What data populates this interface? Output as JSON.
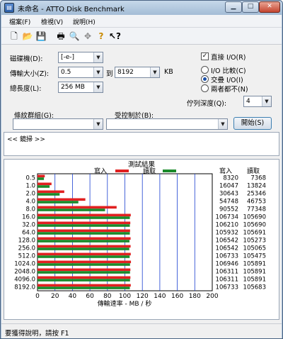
{
  "window": {
    "title": "未命名 - ATTO Disk Benchmark"
  },
  "menu": [
    {
      "label": "檔案(F)"
    },
    {
      "label": "檢視(V)"
    },
    {
      "label": "說明(H)"
    }
  ],
  "toolbar_icons": [
    "new-icon",
    "open-icon",
    "save-icon",
    "print-icon",
    "print-preview-icon",
    "move-icon",
    "help-icon",
    "context-help-icon"
  ],
  "settings": {
    "drive_label": "磁碟機(D):",
    "drive_value": "[-e-]",
    "transfer_label": "傳輸大小(Z):",
    "transfer_from": "0.5",
    "transfer_to_label": "到",
    "transfer_to": "8192",
    "transfer_unit": "KB",
    "total_label": "總長度(L):",
    "total_value": "256 MB",
    "direct_io_label": "直接 I/O(R)",
    "direct_io_checked": true,
    "radio_options": [
      {
        "label": "I/O 比較(C)",
        "selected": false
      },
      {
        "label": "交疊 I/O(I)",
        "selected": true
      },
      {
        "label": "兩者都不(N)",
        "selected": false
      }
    ],
    "queue_label": "佇列深度(Q):",
    "queue_value": "4",
    "control_group_label": "條紋群組(G):",
    "controlled_by_label": "受控制於(B):",
    "start_button": "開始(S)"
  },
  "log": {
    "text": "<< 鏡掃 >>"
  },
  "chart_data": {
    "type": "bar",
    "title": "測試結果",
    "legend": [
      {
        "name": "寫入",
        "color": "#e02020"
      },
      {
        "name": "讀取",
        "color": "#1a8a2a"
      }
    ],
    "xlabel": "傳輸速率 - MB / 秒",
    "xlim": [
      0,
      200
    ],
    "xticks": [
      "0",
      "20",
      "40",
      "60",
      "80",
      "100",
      "120",
      "140",
      "160",
      "180",
      "200"
    ],
    "categories": [
      "0.5",
      "1.0",
      "2.0",
      "4.0",
      "8.0",
      "16.0",
      "32.0",
      "64.0",
      "128.0",
      "256.0",
      "512.0",
      "1024.0",
      "2048.0",
      "4096.0",
      "8192.0"
    ],
    "series": [
      {
        "name": "寫入",
        "color": "#e02020",
        "values": [
          8320,
          16047,
          30643,
          54748,
          90552,
          106734,
          106210,
          105932,
          106542,
          106542,
          106733,
          106946,
          106311,
          106311,
          106733
        ]
      },
      {
        "name": "讀取",
        "color": "#1a8a2a",
        "values": [
          7368,
          13824,
          25346,
          46753,
          77348,
          105690,
          105690,
          105691,
          105273,
          105065,
          105475,
          105891,
          105891,
          105891,
          105683
        ]
      }
    ],
    "column_headers": {
      "write": "寫入",
      "read": "讀取"
    },
    "unit_divisor": 1000
  },
  "status": {
    "text": "要獲得說明，請按 F1"
  }
}
